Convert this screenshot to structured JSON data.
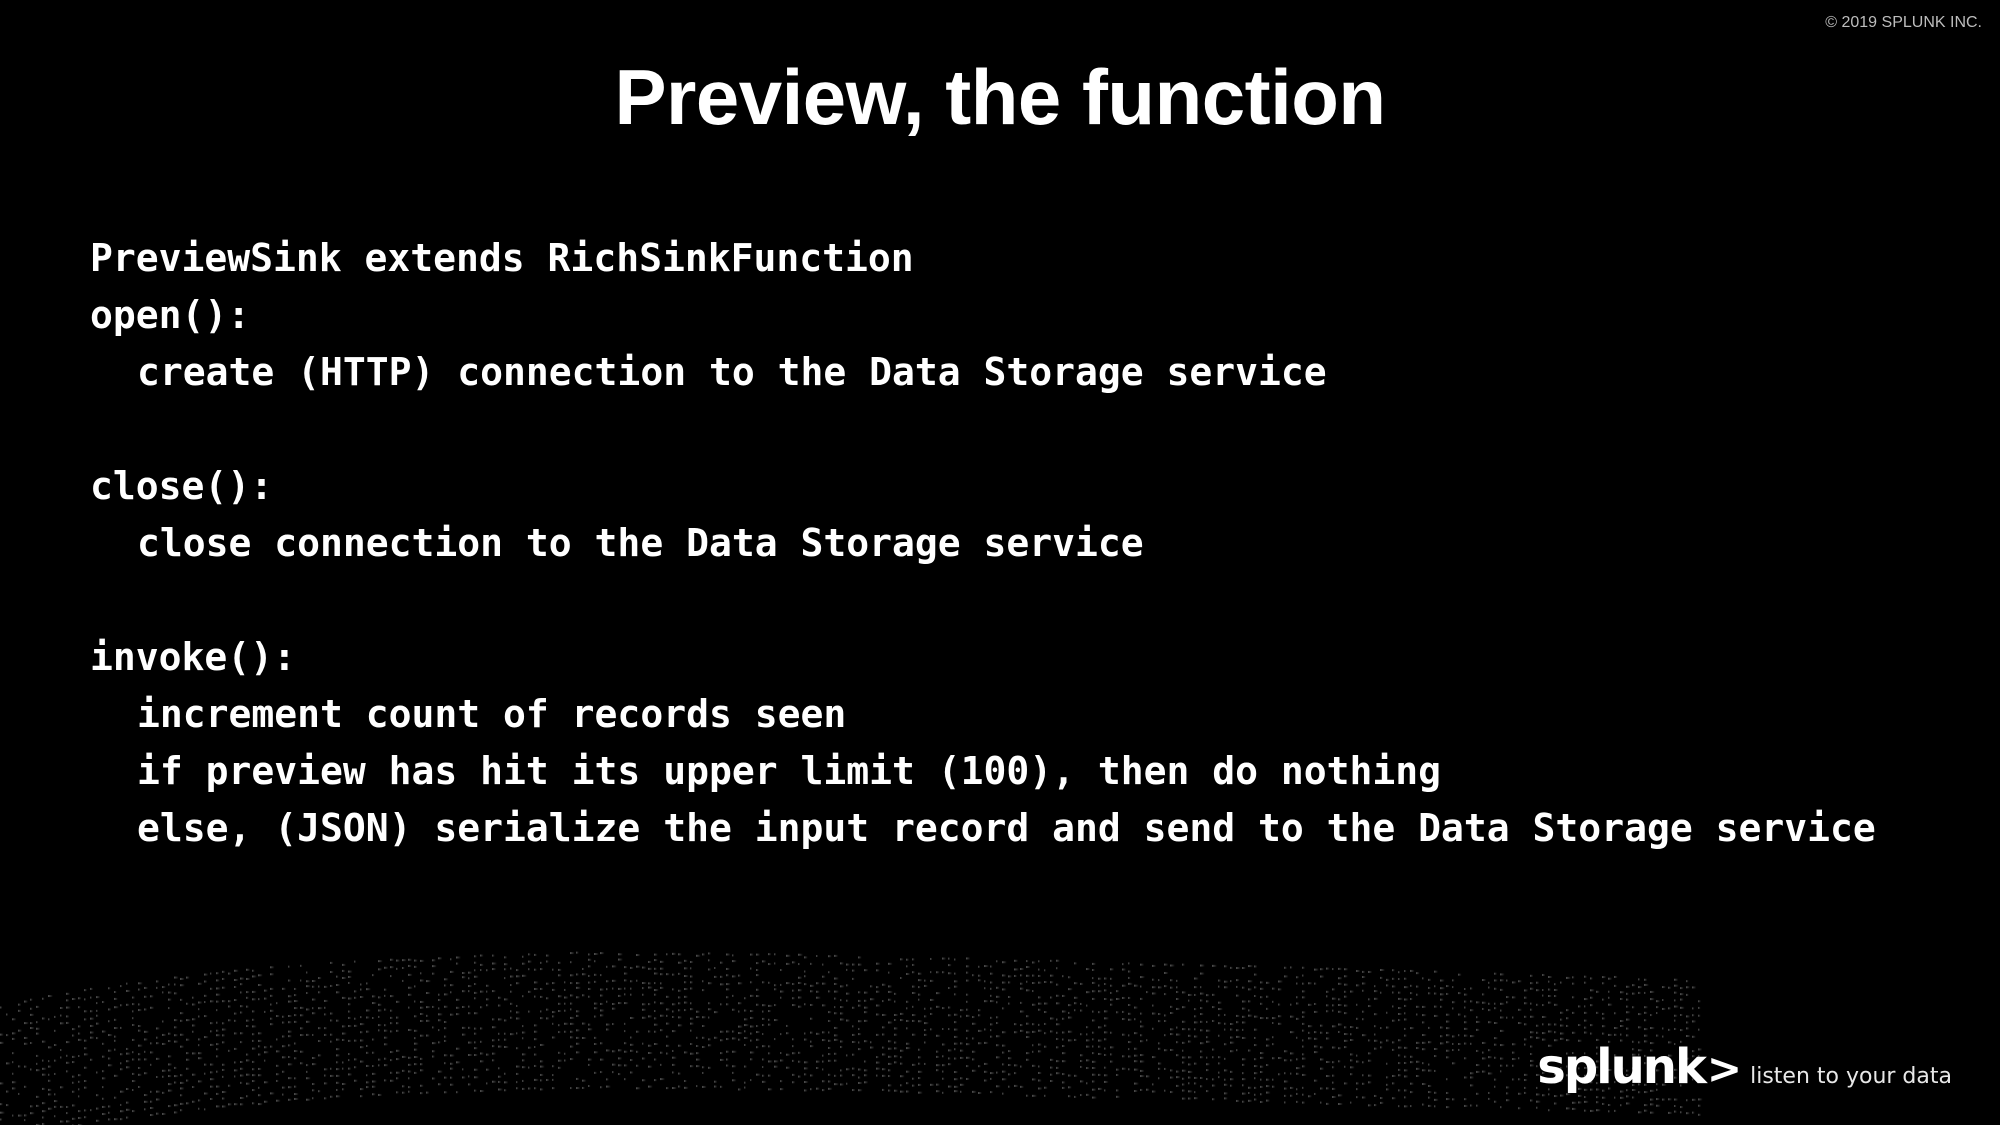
{
  "copyright": "© 2019 SPLUNK INC.",
  "title": "Preview, the function",
  "code": {
    "line1": "PreviewSink extends RichSinkFunction",
    "line2": "open():",
    "line3": "create (HTTP) connection to the Data Storage service",
    "line4": "close():",
    "line5": "close connection to the Data Storage service",
    "line6": "invoke():",
    "line7": "increment count of records seen",
    "line8": "if preview has hit its upper limit (100), then do nothing",
    "line9": "else, (JSON) serialize the input record and send to the Data Storage service"
  },
  "logo": {
    "word": "splunk",
    "chevron": ">",
    "tagline": "listen to your data"
  },
  "colors": {
    "background": "#000000",
    "text": "#ffffff",
    "copyright": "#bdbdbd"
  }
}
